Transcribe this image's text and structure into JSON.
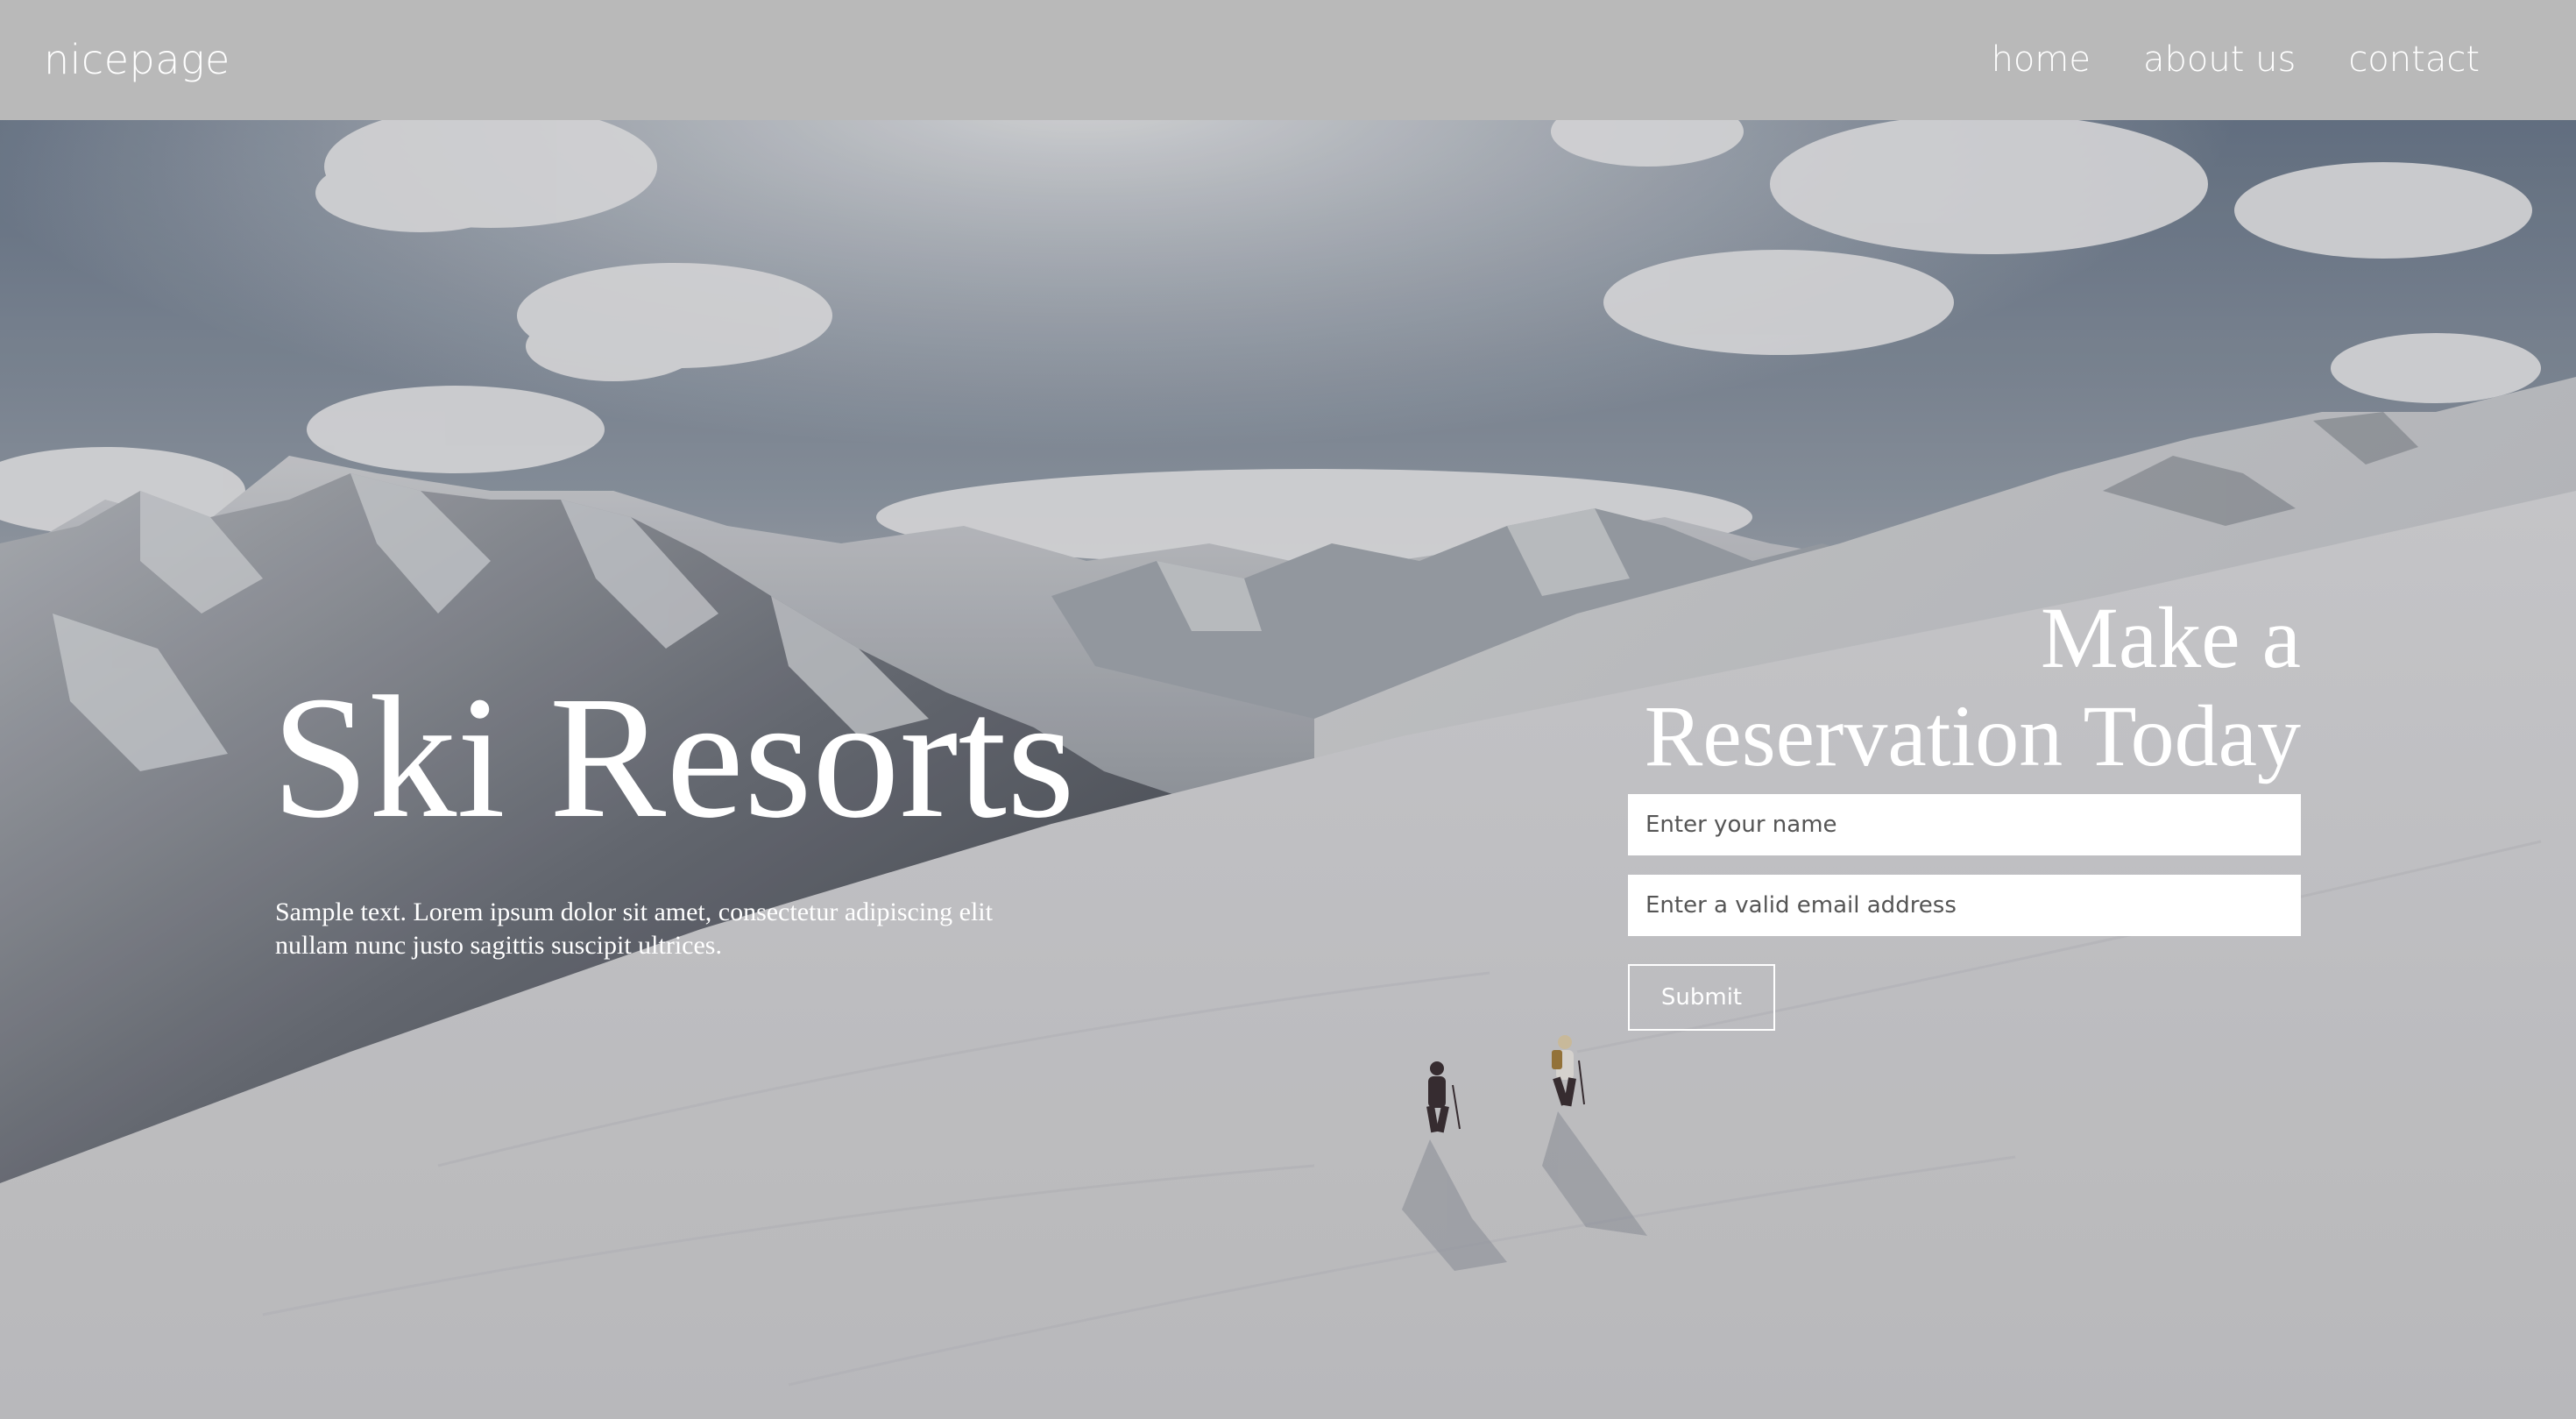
{
  "header": {
    "logo": "nicepage",
    "nav": [
      {
        "label": "home"
      },
      {
        "label": "about us"
      },
      {
        "label": "contact"
      }
    ]
  },
  "hero": {
    "title": "Ski Resorts",
    "text": "Sample text. Lorem ipsum dolor sit amet, consectetur adipiscing elit nullam nunc justo sagittis suscipit ultrices.",
    "background_image": "snowy-mountain-skiers"
  },
  "reservation": {
    "title": "Make a Reservation Today",
    "name_placeholder": "Enter your name",
    "email_placeholder": "Enter a valid email address",
    "submit_label": "Submit"
  },
  "colors": {
    "header_bg": "#b9b9b9",
    "text": "#ffffff",
    "field_bg": "#ffffff"
  }
}
